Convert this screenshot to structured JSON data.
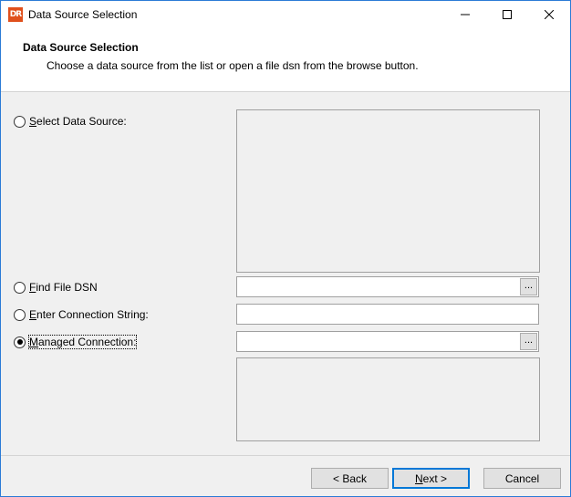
{
  "window": {
    "title": "Data Source Selection",
    "app_icon_text": "DR"
  },
  "header": {
    "title": "Data Source Selection",
    "subtitle": "Choose a data source from the list or open a file dsn from the browse button."
  },
  "options": {
    "select_data_source": {
      "mnemonic": "S",
      "rest": "elect Data Source:",
      "checked": false
    },
    "find_file_dsn": {
      "mnemonic": "F",
      "rest": "ind File DSN",
      "checked": false
    },
    "enter_connection_string": {
      "mnemonic": "E",
      "rest": "nter Connection String:",
      "checked": false
    },
    "managed_connection": {
      "mnemonic": "M",
      "rest": "anaged Connection:",
      "checked": true
    }
  },
  "fields": {
    "file_dsn_value": "",
    "connection_string_value": "",
    "managed_connection_value": "",
    "browse_label": "..."
  },
  "buttons": {
    "back": "< Back",
    "next_mnemonic": "N",
    "next_rest": "ext >",
    "cancel": "Cancel"
  },
  "colors": {
    "accent": "#0078d7",
    "icon": "#e0501c"
  }
}
